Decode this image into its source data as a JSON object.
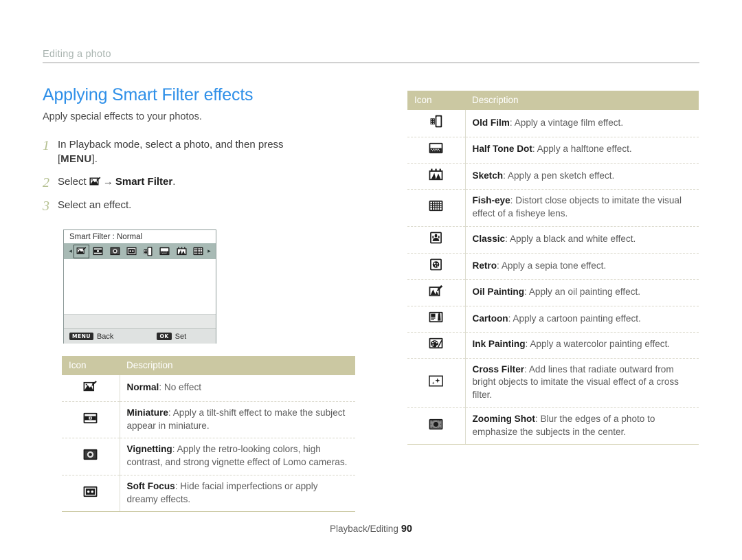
{
  "breadcrumb": {
    "label": "Editing a photo"
  },
  "heading": {
    "title": "Applying Smart Filter effects",
    "subtitle": "Apply special effects to your photos."
  },
  "steps": [
    {
      "number": "1",
      "text_before": "In Playback mode, select a photo, and then press",
      "bracket_open": "[",
      "key": "MENU",
      "bracket_close": "].",
      "text_after": ""
    },
    {
      "number": "2",
      "text_before": "Select",
      "icon": "smart-filter-icon",
      "arrow": "→",
      "bold_target": "Smart Filter",
      "text_after": "."
    },
    {
      "number": "3",
      "text_before": "Select an effect.",
      "text_after": ""
    }
  ],
  "lcd": {
    "title": "Smart Filter : Normal",
    "left_arrow": "◂",
    "right_arrow": "▸",
    "icons": [
      "normal-filter-icon",
      "miniature-filter-icon",
      "vignetting-filter-icon",
      "soft-focus-filter-icon",
      "old-film-filter-icon",
      "half-tone-dot-filter-icon",
      "sketch-filter-icon",
      "fish-eye-filter-icon"
    ],
    "selected_index": 0,
    "footer": {
      "menu_chip": "MENU",
      "menu_label": "Back",
      "ok_chip": "OK",
      "ok_label": "Set"
    }
  },
  "left_table": {
    "headers": {
      "icon": "Icon",
      "description": "Description"
    },
    "rows": [
      {
        "icon": "normal-filter-icon",
        "name": "Normal",
        "sep": ": ",
        "desc": "No effect"
      },
      {
        "icon": "miniature-filter-icon",
        "name": "Miniature",
        "sep": ": ",
        "desc": "Apply a tilt-shift effect to make the subject appear in miniature."
      },
      {
        "icon": "vignetting-filter-icon",
        "name": "Vignetting",
        "sep": ": ",
        "desc": "Apply the retro-looking colors, high contrast, and strong vignette effect of Lomo cameras."
      },
      {
        "icon": "soft-focus-filter-icon",
        "name": "Soft Focus",
        "sep": ": ",
        "desc": "Hide facial imperfections or apply dreamy effects."
      }
    ]
  },
  "right_table": {
    "headers": {
      "icon": "Icon",
      "description": "Description"
    },
    "rows": [
      {
        "icon": "old-film-filter-icon",
        "name": "Old Film",
        "sep": ": ",
        "desc": "Apply a vintage film effect."
      },
      {
        "icon": "half-tone-dot-filter-icon",
        "name": "Half Tone Dot",
        "sep": ": ",
        "desc": "Apply a halftone effect."
      },
      {
        "icon": "sketch-filter-icon",
        "name": "Sketch",
        "sep": ": ",
        "desc": "Apply a pen sketch effect."
      },
      {
        "icon": "fish-eye-filter-icon",
        "name": "Fish-eye",
        "sep": ": ",
        "desc": "Distort close objects to imitate the visual effect of a fisheye lens."
      },
      {
        "icon": "classic-filter-icon",
        "name": "Classic",
        "sep": ": ",
        "desc": "Apply a black and white effect."
      },
      {
        "icon": "retro-filter-icon",
        "name": "Retro",
        "sep": ": ",
        "desc": "Apply a sepia tone effect."
      },
      {
        "icon": "oil-painting-filter-icon",
        "name": "Oil Painting",
        "sep": ": ",
        "desc": "Apply an oil painting effect."
      },
      {
        "icon": "cartoon-filter-icon",
        "name": "Cartoon",
        "sep": ": ",
        "desc": "Apply a cartoon painting effect."
      },
      {
        "icon": "ink-painting-filter-icon",
        "name": "Ink Painting",
        "sep": ": ",
        "desc": "Apply a watercolor painting effect."
      },
      {
        "icon": "cross-filter-icon",
        "name": "Cross Filter",
        "sep": ": ",
        "desc": "Add lines that radiate outward from bright objects to imitate the visual effect of a cross filter."
      },
      {
        "icon": "zooming-shot-filter-icon",
        "name": "Zooming Shot",
        "sep": ": ",
        "desc": "Blur the edges of a photo to emphasize the subjects in the center."
      }
    ]
  },
  "footer": {
    "section": "Playback/Editing",
    "page_number": "90"
  },
  "colors": {
    "heading_blue": "#2e8fe8",
    "table_header_khaki": "#cbc8a2",
    "step_number_green": "#b4c090",
    "lcd_strip_teal": "#a8bab5",
    "body_text": "#5c5c5c"
  }
}
